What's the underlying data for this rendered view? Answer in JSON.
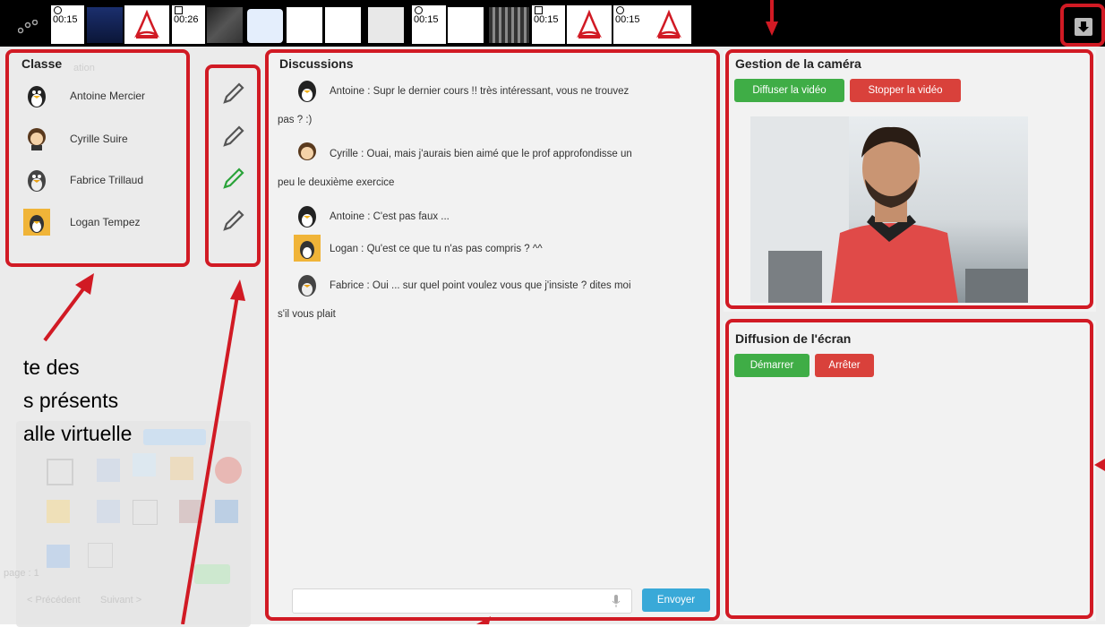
{
  "topbar": {
    "tile_times": [
      "00:15",
      "00:26",
      "00:15",
      "00:15",
      "00:15"
    ]
  },
  "classe": {
    "title": "Classe",
    "students": [
      {
        "name": "Antoine Mercier",
        "avatar": "tux-avatar"
      },
      {
        "name": "Cyrille Suire",
        "avatar": "cartoon-avatar"
      },
      {
        "name": "Fabrice Trillaud",
        "avatar": "tux-avatar"
      },
      {
        "name": "Logan Tempez",
        "avatar": "tux-avatar"
      }
    ],
    "pencil_colors": [
      "#555555",
      "#555555",
      "#2aa33a",
      "#555555"
    ]
  },
  "discussions": {
    "title": "Discussions",
    "messages": [
      {
        "line1": "Antoine : Supr le dernier cours !! très intéressant, vous ne trouvez",
        "line2": "pas ? :)"
      },
      {
        "line1": "Cyrille : Ouai, mais j'aurais bien aimé que le prof approfondisse un",
        "line2": "peu le deuxième exercice"
      },
      {
        "line1": "Antoine : C'est pas faux ...",
        "line2": ""
      },
      {
        "line1": "Logan : Qu'est ce que tu n'as pas compris ? ^^",
        "line2": ""
      },
      {
        "line1": "Fabrice : Oui ... sur quel point voulez vous que j'insiste ? dites moi",
        "line2": "s'il vous plait"
      }
    ],
    "send_label": "Envoyer"
  },
  "camera": {
    "title": "Gestion de la caméra",
    "start_label": "Diffuser la vidéo",
    "stop_label": "Stopper la vidéo"
  },
  "screen": {
    "title": "Diffusion de l'écran",
    "start_label": "Démarrer",
    "stop_label": "Arrêter"
  },
  "annotation": {
    "line1": "te des",
    "line2": "s présents",
    "line3": "alle virtuelle"
  },
  "ghost": {
    "page_label": "page : 1",
    "prev_label": "< Précédent",
    "next_label": "Suivant >"
  },
  "colors": {
    "annotation_red": "#d11a24",
    "button_green": "#3fad46",
    "button_red": "#d9413b",
    "button_blue": "#39a9d8"
  }
}
